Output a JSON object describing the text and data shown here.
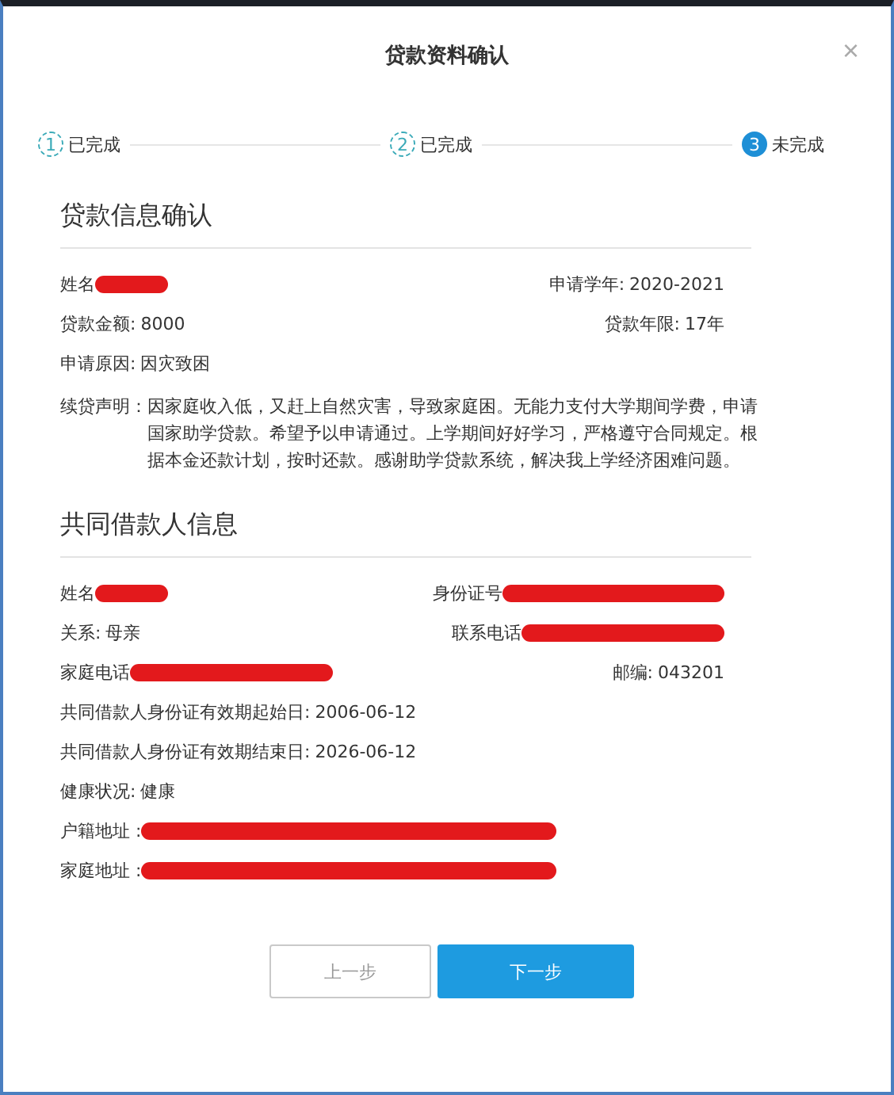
{
  "dialog": {
    "title": "贷款资料确认",
    "close": "×"
  },
  "steps": [
    {
      "number": "1",
      "label": "已完成",
      "completed": true
    },
    {
      "number": "2",
      "label": "已完成",
      "completed": true
    },
    {
      "number": "3",
      "label": "未完成",
      "completed": false
    }
  ],
  "sections": [
    {
      "heading": "贷款信息确认",
      "rows": [
        [
          {
            "label": "姓名",
            "kind": "name"
          },
          {
            "label": "申请学年:",
            "value": "2020-2021"
          }
        ],
        [
          {
            "label": "贷款金额:",
            "value": "8000"
          },
          {
            "label": "贷款年限:",
            "value": "17年"
          }
        ],
        [
          {
            "label": "申请原因:",
            "value": "因灾致困"
          }
        ]
      ],
      "statement": {
        "label": "续贷声明：",
        "text": "因家庭收入低，又赶上自然灾害，导致家庭困。无能力支付大学期间学费，申请国家助学贷款。希望予以申请通过。上学期间好好学习，严格遵守合同规定。根据本金还款计划，按时还款。感谢助学贷款系统，解决我上学经济困难问题。"
      }
    },
    {
      "heading": "共同借款人信息",
      "rows": [
        [
          {
            "label": "姓名",
            "kind": "name"
          },
          {
            "label": "身份证号",
            "kind": "idnumber"
          }
        ],
        [
          {
            "label": "关系:",
            "value": "母亲"
          },
          {
            "label": "联系电话",
            "kind": "phone"
          }
        ],
        [
          {
            "label": "家庭电话",
            "kind": "phone"
          },
          {
            "label": "邮编:",
            "value": "043201"
          }
        ],
        [
          {
            "label": "共同借款人身份证有效期起始日:",
            "value": "2006-06-12"
          }
        ],
        [
          {
            "label": "共同借款人身份证有效期结束日:",
            "value": "2026-06-12"
          }
        ],
        [
          {
            "label": "健康状况:",
            "value": "健康"
          }
        ],
        [
          {
            "label": "户籍地址 :",
            "kind": "address"
          }
        ],
        [
          {
            "label": "家庭地址 :",
            "kind": "address"
          }
        ]
      ]
    }
  ],
  "buttons": [
    {
      "label": "上一步",
      "primary": false
    },
    {
      "label": "下一步",
      "primary": true
    }
  ]
}
